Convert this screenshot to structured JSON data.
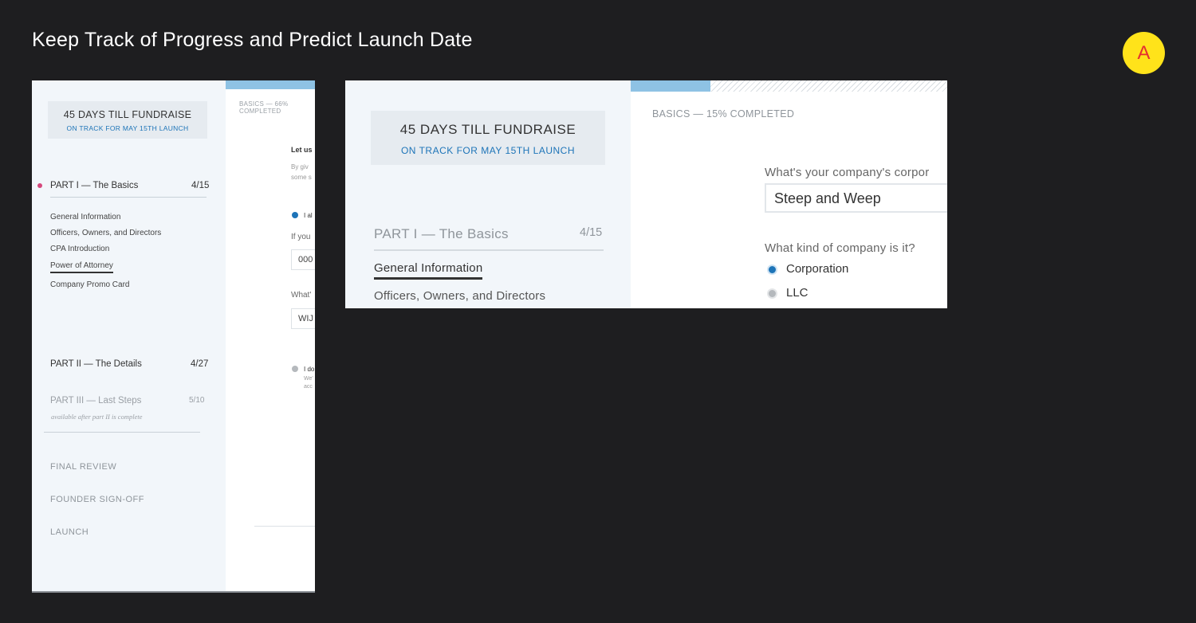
{
  "title": "Keep Track of Progress and Predict Launch Date",
  "badge": "A",
  "left": {
    "fundraise": "45 DAYS TILL FUNDRAISE",
    "on_track": "ON TRACK FOR MAY 15TH LAUNCH",
    "part1": {
      "label": "PART I — The Basics",
      "count": "4/15"
    },
    "part1_items": [
      "General Information",
      "Officers, Owners, and Directors",
      "CPA Introduction",
      "Power of Attorney",
      "Company Promo Card"
    ],
    "part2": {
      "label": "PART II — The Details",
      "count": "4/27"
    },
    "part3": {
      "label": "PART III — Last Steps",
      "count": "5/10",
      "note": "available after part II is complete"
    },
    "final_steps": [
      "FINAL REVIEW",
      "FOUNDER SIGN-OFF",
      "LAUNCH"
    ],
    "progress_label_1": "BASICS — 66%",
    "progress_label_2": "COMPLETED",
    "progress_fraction": 0.66,
    "main": {
      "heading": "Let us",
      "sub1": "By giv",
      "sub2": "some s",
      "radio1": "I al",
      "q1": "If you",
      "input1": "000",
      "q2": "What'",
      "input2": "WIJ",
      "radio2": "I do",
      "radio2_sub1": "We'",
      "radio2_sub2": "acc"
    }
  },
  "right": {
    "fundraise": "45 DAYS TILL FUNDRAISE",
    "on_track": "ON TRACK FOR MAY 15TH LAUNCH",
    "part1": {
      "label": "PART I — The Basics",
      "count": "4/15"
    },
    "active_item": "General Information",
    "next_item": "Officers, Owners, and Directors",
    "progress_label": "BASICS — 15% COMPLETED",
    "progress_fraction": 0.15,
    "q1": "What's your company's corpor",
    "company_name": "Steep and Weep",
    "q2": "What kind of company is it?",
    "options": [
      "Corporation",
      "LLC"
    ],
    "selected_option": "Corporation"
  },
  "colors": {
    "background": "#1e1e20",
    "accent_blue": "#1d74b8",
    "progress_blue": "#8ec2e4",
    "badge_yellow": "#ffe31a",
    "badge_red": "#e4302f",
    "pink_dot": "#d5487c"
  }
}
